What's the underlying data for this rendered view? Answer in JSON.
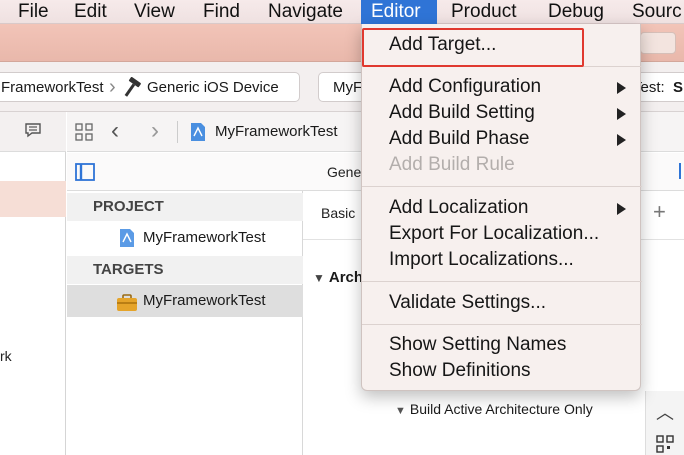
{
  "menubar": {
    "items": [
      "File",
      "Edit",
      "View",
      "Find",
      "Navigate",
      "Editor",
      "Product",
      "Debug",
      "Sourc"
    ],
    "active": "Editor",
    "active_color": "#2f74d6"
  },
  "scheme": {
    "target": "FrameworkTest",
    "device": "Generic iOS Device",
    "status_left": "MyF",
    "status_right_label": "Test:",
    "status_right_value": "S"
  },
  "jumpbar": {
    "title": "MyFrameworkTest"
  },
  "tabbar": {
    "general_tab": "Gene"
  },
  "navigator": {
    "fragment": "rk"
  },
  "list": {
    "project_header": "PROJECT",
    "project_item": "MyFrameworkTest",
    "targets_header": "TARGETS",
    "target_item": "MyFrameworkTest"
  },
  "settings": {
    "basic_tab": "Basic",
    "arch_header": "Archi",
    "arch_row": "Build Active Architecture Only"
  },
  "editor_menu": {
    "add_target": "Add Target...",
    "add_configuration": "Add Configuration",
    "add_build_setting": "Add Build Setting",
    "add_build_phase": "Add Build Phase",
    "add_build_rule": "Add Build Rule",
    "add_localization": "Add Localization",
    "export_localization": "Export For Localization...",
    "import_localizations": "Import Localizations...",
    "validate_settings": "Validate Settings...",
    "show_setting_names": "Show Setting Names",
    "show_definitions": "Show Definitions",
    "highlight_color": "#e0392f"
  }
}
